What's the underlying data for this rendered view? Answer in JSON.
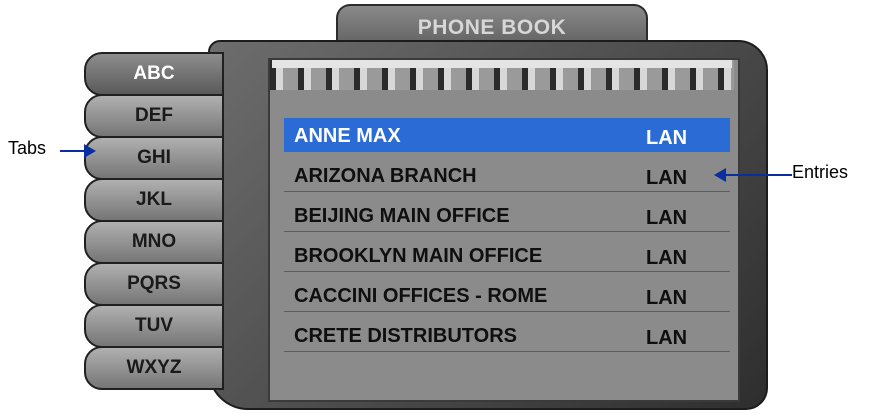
{
  "title": "PHONE BOOK",
  "tabs": [
    {
      "label": "ABC",
      "active": true
    },
    {
      "label": "DEF"
    },
    {
      "label": "GHI"
    },
    {
      "label": "JKL"
    },
    {
      "label": "MNO"
    },
    {
      "label": "PQRS"
    },
    {
      "label": "TUV"
    },
    {
      "label": "WXYZ"
    }
  ],
  "entries": [
    {
      "name": "ANNE MAX",
      "type": "LAN",
      "selected": true
    },
    {
      "name": "ARIZONA BRANCH",
      "type": "LAN"
    },
    {
      "name": "BEIJING MAIN OFFICE",
      "type": "LAN"
    },
    {
      "name": "BROOKLYN MAIN OFFICE",
      "type": "LAN"
    },
    {
      "name": "CACCINI OFFICES - ROME",
      "type": "LAN"
    },
    {
      "name": "CRETE DISTRIBUTORS",
      "type": "LAN"
    }
  ],
  "annotations": {
    "tabs_label": "Tabs",
    "entries_label": "Entries"
  }
}
